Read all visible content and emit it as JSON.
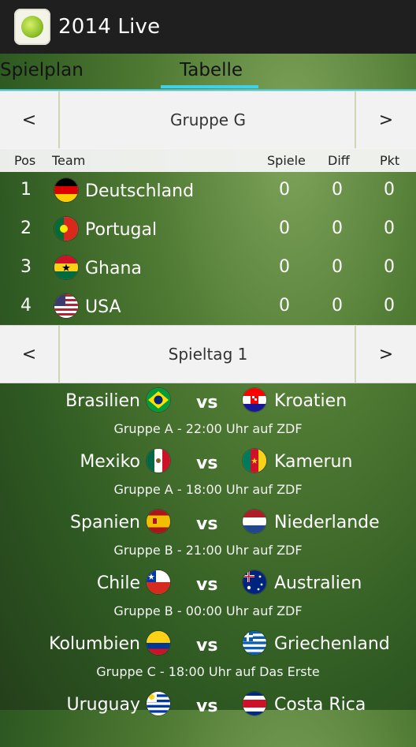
{
  "app": {
    "title": "2014 Live"
  },
  "tabs": [
    {
      "label": "Spielplan"
    },
    {
      "label": "Tabelle"
    }
  ],
  "group_nav": {
    "prev": "<",
    "label": "Gruppe G",
    "next": ">"
  },
  "table": {
    "headers": {
      "pos": "Pos",
      "team": "Team",
      "games": "Spiele",
      "diff": "Diff",
      "points": "Pkt"
    },
    "rows": [
      {
        "pos": "1",
        "team": "Deutschland",
        "games": "0",
        "diff": "0",
        "points": "0",
        "flag": "germany-flag-icon"
      },
      {
        "pos": "2",
        "team": "Portugal",
        "games": "0",
        "diff": "0",
        "points": "0",
        "flag": "portugal-flag-icon"
      },
      {
        "pos": "3",
        "team": "Ghana",
        "games": "0",
        "diff": "0",
        "points": "0",
        "flag": "ghana-flag-icon"
      },
      {
        "pos": "4",
        "team": "USA",
        "games": "0",
        "diff": "0",
        "points": "0",
        "flag": "usa-flag-icon"
      }
    ]
  },
  "matchday_nav": {
    "prev": "<",
    "label": "Spieltag 1",
    "next": ">"
  },
  "matches": [
    {
      "home": "Brasilien",
      "away": "Kroatien",
      "vs": "vs",
      "info": "Gruppe A - 22:00 Uhr auf ZDF"
    },
    {
      "home": "Mexiko",
      "away": "Kamerun",
      "vs": "vs",
      "info": "Gruppe A - 18:00 Uhr auf ZDF"
    },
    {
      "home": "Spanien",
      "away": "Niederlande",
      "vs": "vs",
      "info": "Gruppe B - 21:00 Uhr auf ZDF"
    },
    {
      "home": "Chile",
      "away": "Australien",
      "vs": "vs",
      "info": "Gruppe B - 00:00 Uhr auf ZDF"
    },
    {
      "home": "Kolumbien",
      "away": "Griechenland",
      "vs": "vs",
      "info": "Gruppe C - 18:00 Uhr auf Das Erste"
    },
    {
      "home": "Uruguay",
      "away": "Costa Rica",
      "vs": "vs",
      "info": ""
    }
  ]
}
